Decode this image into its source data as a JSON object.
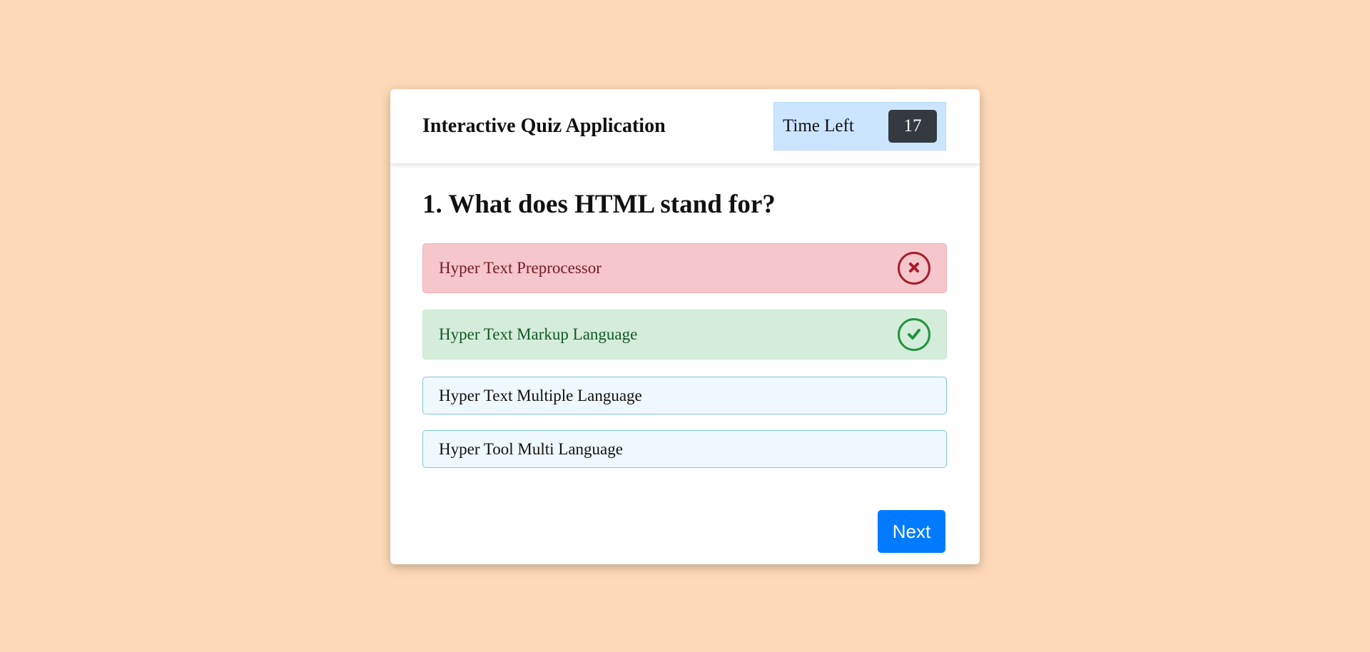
{
  "app": {
    "title": "Interactive Quiz Application"
  },
  "timer": {
    "label": "Time Left",
    "seconds": "17"
  },
  "question": {
    "text": "1. What does HTML stand for?"
  },
  "options": [
    {
      "text": "Hyper Text Preprocessor",
      "state": "incorrect",
      "icon": "cross-icon"
    },
    {
      "text": "Hyper Text Markup Language",
      "state": "correct",
      "icon": "tick-icon"
    },
    {
      "text": "Hyper Text Multiple Language",
      "state": "default"
    },
    {
      "text": "Hyper Tool Multi Language",
      "state": "default"
    }
  ],
  "footer": {
    "next_label": "Next"
  },
  "colors": {
    "background": "#fdd9b7",
    "incorrect_bg": "#f5c6cb",
    "incorrect_fg": "#721c24",
    "correct_bg": "#d4edda",
    "correct_fg": "#155724",
    "option_bg": "#f0f8ff",
    "timer_bg": "#cce5ff",
    "timer_sec_bg": "#343a40",
    "next_button": "#007bff"
  }
}
